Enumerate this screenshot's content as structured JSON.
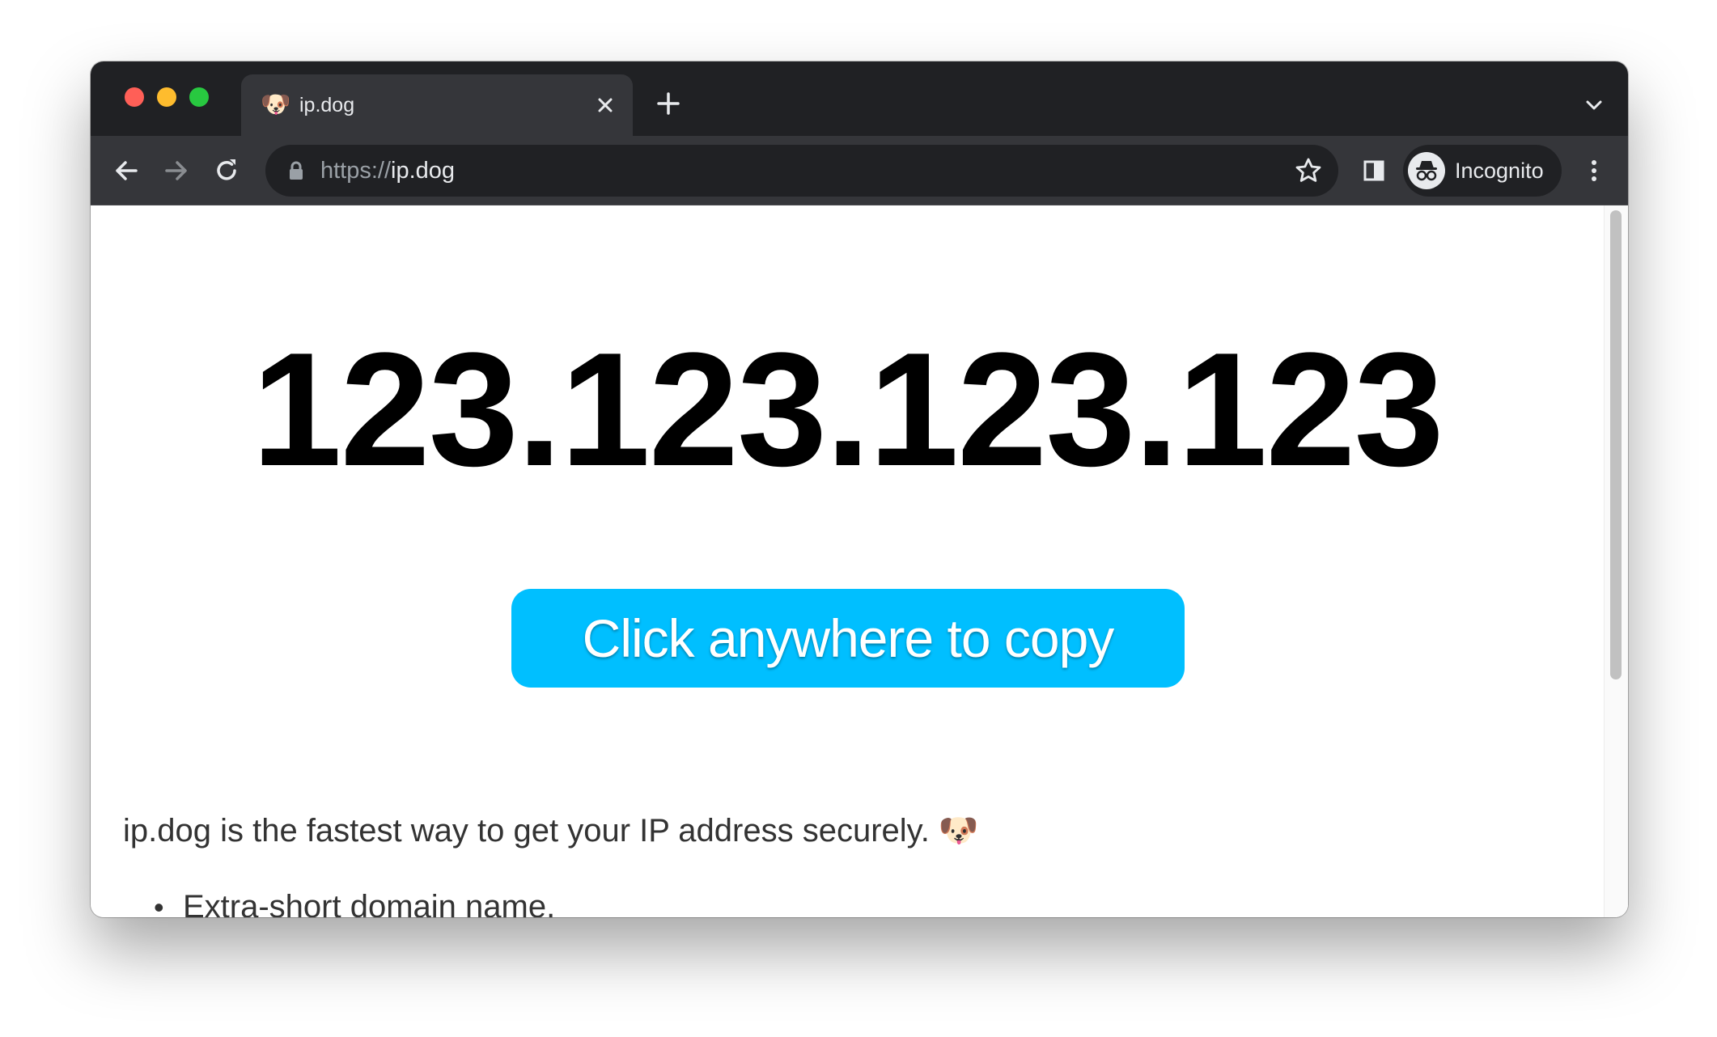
{
  "browser": {
    "tab": {
      "title": "ip.dog",
      "favicon": "🐶"
    },
    "omnibox": {
      "scheme": "https://",
      "host": "ip.dog"
    },
    "profile_label": "Incognito",
    "colors": {
      "tabstrip": "#202124",
      "toolbar": "#35363a",
      "traffic_red": "#ff5f57",
      "traffic_yellow": "#febc2e",
      "traffic_green": "#28c840"
    }
  },
  "page": {
    "ip_address": "123.123.123.123",
    "copy_button_label": "Click anywhere to copy",
    "description": "ip.dog is the fastest way to get your IP address securely. 🐶",
    "features": [
      "Extra-short domain name."
    ],
    "colors": {
      "button_bg": "#00bfff",
      "text": "#333333"
    }
  }
}
